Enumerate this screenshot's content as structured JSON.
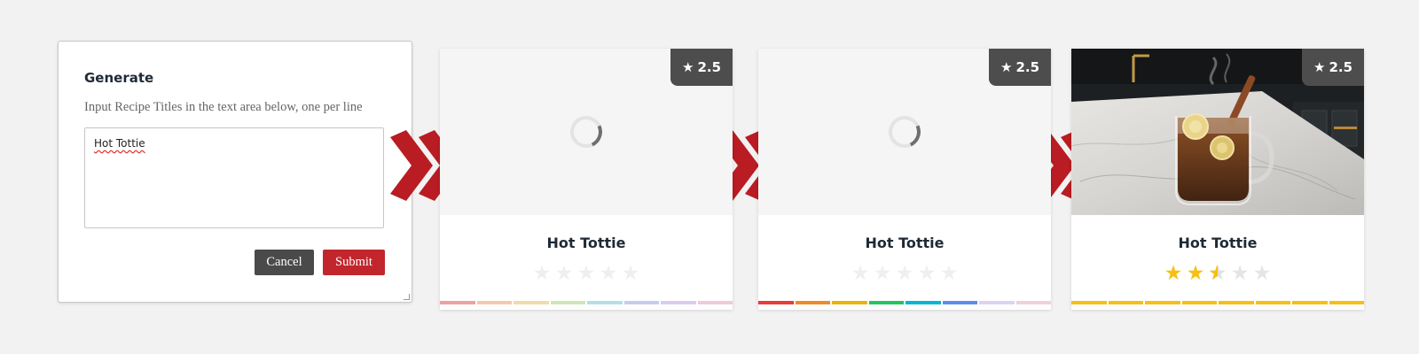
{
  "dialog": {
    "title": "Generate",
    "description": "Input Recipe Titles in the text area below, one per line",
    "textarea_value": "Hot Tottie",
    "cancel_label": "Cancel",
    "submit_label": "Submit"
  },
  "cards": [
    {
      "state": "loading",
      "badge_rating": "2.5",
      "title": "Hot Tottie",
      "rating": 0,
      "bar_colors": [
        "#f0a0a0",
        "#f3c9b0",
        "#f0dca8",
        "#cfe6b8",
        "#b4dfe6",
        "#c6cbef",
        "#dccbef",
        "#efc9dc"
      ]
    },
    {
      "state": "loading",
      "badge_rating": "2.5",
      "title": "Hot Tottie",
      "rating": 0,
      "bar_colors": [
        "#ea3b3b",
        "#f08a27",
        "#eab308",
        "#22c55e",
        "#06b6d4",
        "#5b8def",
        "#ddd2f2",
        "#efd0df"
      ]
    },
    {
      "state": "complete",
      "badge_rating": "2.5",
      "title": "Hot Tottie",
      "rating": 2.5,
      "bar_colors": [
        "#f6c012",
        "#f6c012",
        "#f6c012",
        "#f6c012",
        "#f6c012",
        "#f6c012",
        "#f6c012",
        "#f6c012"
      ]
    }
  ],
  "icons": {
    "star": "★",
    "arrow": "double-chevron-right-icon"
  },
  "colors": {
    "accent_red": "#c1262d",
    "arrow_red": "#b91c22",
    "star_gold": "#f6c012",
    "badge_bg": "#4d4d4d"
  }
}
